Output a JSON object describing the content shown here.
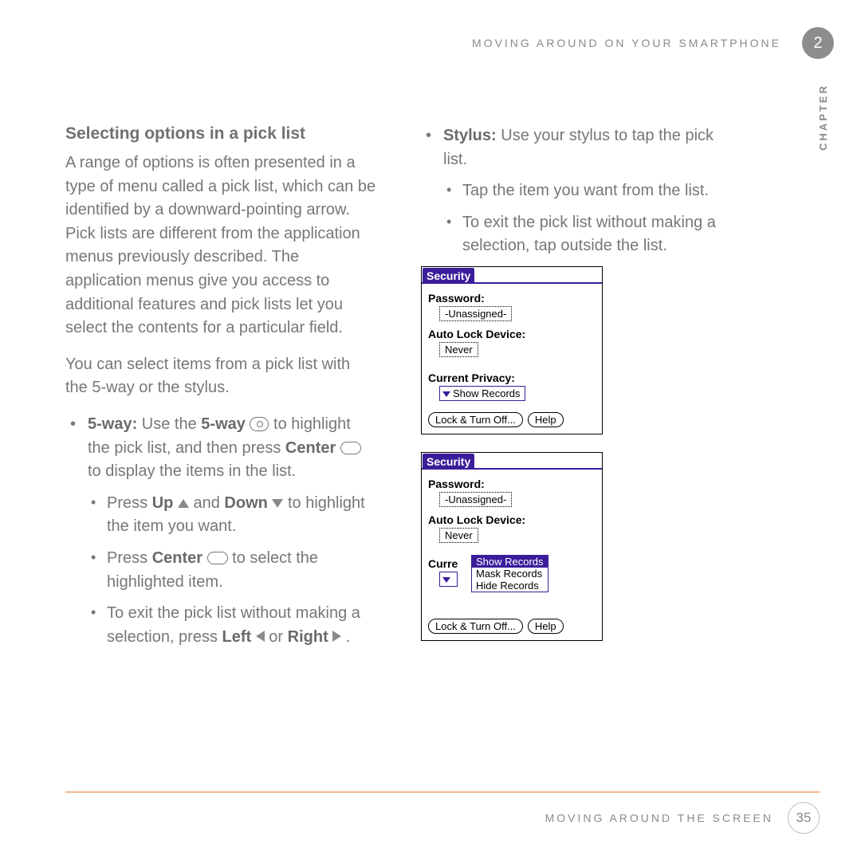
{
  "header": {
    "running": "MOVING AROUND ON YOUR SMARTPHONE",
    "chapter_num": "2",
    "chapter_word": "CHAPTER"
  },
  "left": {
    "heading": "Selecting options in a pick list",
    "para1": "A range of options is often presented in a type of menu called a pick list, which can be identified by a downward-pointing arrow. Pick lists are different from the application menus previously described. The application menus give you access to additional features and pick lists let you select the contents for a particular field.",
    "para2": "You can select items from a pick list with the 5-way or the stylus.",
    "fiveway_label": "5-way:",
    "fiveway_pre": " Use the ",
    "fiveway_bold2": "5-way",
    "fiveway_mid": " to highlight the pick list, and then press ",
    "center_bold": "Center",
    "fiveway_end": " to display the items in the list.",
    "sub1_a": "Press ",
    "sub1_up": "Up",
    "sub1_b": " and ",
    "sub1_down": "Down",
    "sub1_c": " to highlight the item you want.",
    "sub2_a": "Press ",
    "sub2_center": "Center",
    "sub2_b": " to select the highlighted item.",
    "sub3_a": "To exit the pick list without making a selection, press ",
    "sub3_left": "Left",
    "sub3_b": " or ",
    "sub3_right": "Right",
    "sub3_c": " ."
  },
  "right": {
    "stylus_label": "Stylus:",
    "stylus_text": " Use your stylus to tap the pick list.",
    "sub1": "Tap the item you want from the list.",
    "sub2": "To exit the pick list without making a selection, tap outside the list."
  },
  "panel": {
    "title": "Security",
    "password_lbl": "Password:",
    "password_val": "-Unassigned-",
    "autolock_lbl": "Auto Lock Device:",
    "autolock_val": "Never",
    "privacy_lbl": "Current Privacy:",
    "privacy_val": "Show Records",
    "privacy_lbl_cut": "Curre",
    "options": [
      "Show Records",
      "Mask Records",
      "Hide Records"
    ],
    "btn_lock": "Lock & Turn Off...",
    "btn_help": "Help"
  },
  "footer": {
    "text": "MOVING AROUND THE SCREEN",
    "page": "35"
  }
}
